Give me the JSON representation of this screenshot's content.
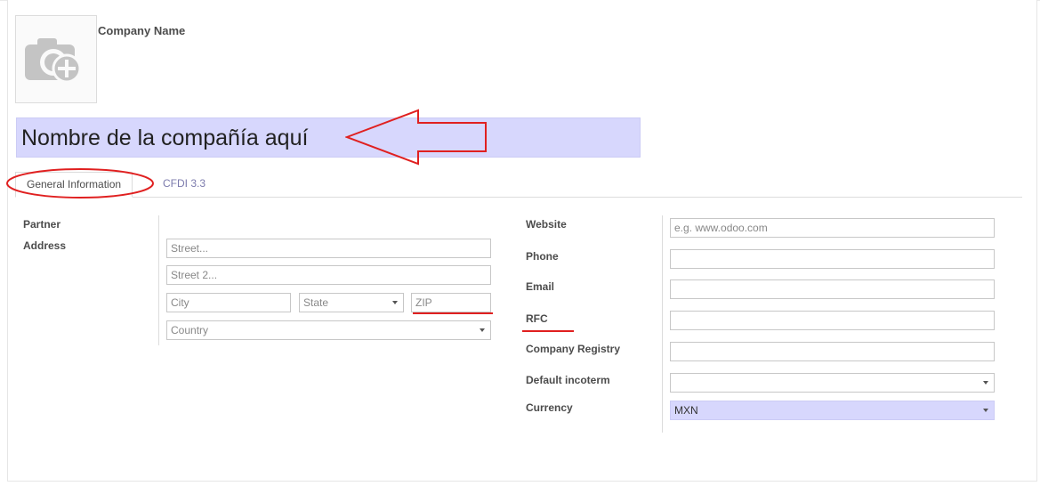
{
  "header": {
    "company_label": "Company Name",
    "name_value": "Nombre de la compañía aquí"
  },
  "tabs": [
    {
      "label": "General Information"
    },
    {
      "label": "CFDI 3.3"
    }
  ],
  "left": {
    "partner_label": "Partner",
    "address_label": "Address",
    "street_placeholder": "Street...",
    "street2_placeholder": "Street 2...",
    "city_placeholder": "City",
    "state_placeholder": "State",
    "zip_placeholder": "ZIP",
    "country_placeholder": "Country"
  },
  "right": {
    "website_label": "Website",
    "website_placeholder": "e.g. www.odoo.com",
    "phone_label": "Phone",
    "email_label": "Email",
    "rfc_label": "RFC",
    "registry_label": "Company Registry",
    "incoterm_label": "Default incoterm",
    "currency_label": "Currency",
    "currency_value": "MXN"
  },
  "colors": {
    "highlight": "#d7d7fd",
    "annotation_red": "#e02020",
    "tab_link": "#7c7bad"
  }
}
